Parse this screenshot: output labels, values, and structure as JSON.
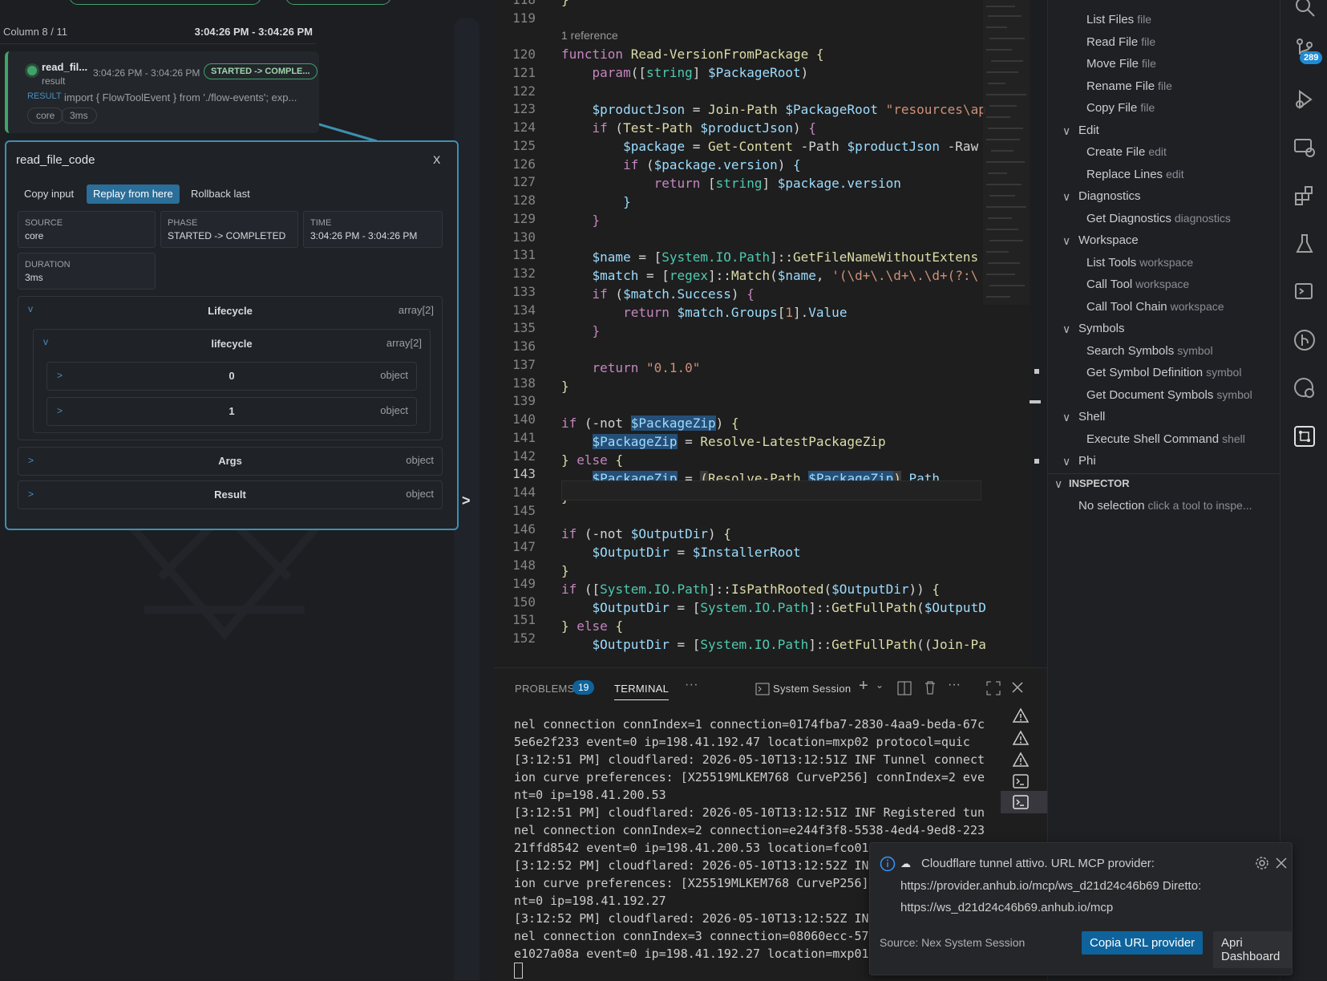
{
  "flow": {
    "column_label": "Column 8 / 11",
    "column_time": "3:04:26 PM - 3:04:26 PM",
    "node": {
      "name": "read_fil...",
      "kind": "result",
      "time": "3:04:26 PM - 3:04:26 PM",
      "phase_badge": "STARTED -> COMPLE...",
      "result_label": "RESULT",
      "result_preview": "import { FlowToolEvent } from './flow-events'; exp...",
      "chip_source": "core",
      "chip_duration": "3ms",
      "status_color": "#3fa36a"
    },
    "expand_arrow": ">"
  },
  "inspector_popup": {
    "title": "read_file_code",
    "close": "X",
    "buttons": {
      "copy_input": "Copy input",
      "replay": "Replay from here",
      "rollback": "Rollback last"
    },
    "fields": {
      "source_key": "SOURCE",
      "source_val": "core",
      "phase_key": "PHASE",
      "phase_val": "STARTED -> COMPLETED",
      "time_key": "TIME",
      "time_val": "3:04:26 PM - 3:04:26 PM",
      "duration_key": "DURATION",
      "duration_val": "3ms"
    },
    "lifecycle": {
      "chevron": "v",
      "title": "Lifecycle",
      "type": "array[2]"
    },
    "lifecycle_inner": {
      "chevron": "v",
      "title": "lifecycle",
      "type": "array[2]"
    },
    "item0": {
      "chevron": ">",
      "title": "0",
      "type": "object"
    },
    "item1": {
      "chevron": ">",
      "title": "1",
      "type": "object"
    },
    "args": {
      "chevron": ">",
      "title": "Args",
      "type": "object"
    },
    "result": {
      "chevron": ">",
      "title": "Result",
      "type": "object"
    },
    "accent_color": "#3f8fb0"
  },
  "editor": {
    "line_numbers": [
      "118",
      "119",
      "120",
      "121",
      "122",
      "123",
      "124",
      "125",
      "126",
      "127",
      "128",
      "129",
      "130",
      "131",
      "132",
      "133",
      "134",
      "135",
      "136",
      "137",
      "138",
      "139",
      "140",
      "141",
      "142",
      "143",
      "144",
      "145",
      "146",
      "147",
      "148",
      "149",
      "150",
      "151",
      "152"
    ],
    "current_line": "143",
    "codelens": "1 reference"
  },
  "panel": {
    "problems_label": "PROBLEMS",
    "problems_count": "19",
    "terminal_label": "TERMINAL",
    "more": "···",
    "session_label": "System Session",
    "terminal_lines": [
      "nel connection connIndex=1 connection=0174fba7-2830-4aa9-beda-67c",
      "5e6e2f233 event=0 ip=198.41.192.47 location=mxp02 protocol=quic",
      "[3:12:51 PM] cloudflared: 2026-05-10T13:12:51Z INF Tunnel connect",
      "ion curve preferences: [X25519MLKEM768 CurveP256] connIndex=2 eve",
      "nt=0 ip=198.41.200.53",
      "[3:12:51 PM] cloudflared: 2026-05-10T13:12:51Z INF Registered tun",
      "nel connection connIndex=2 connection=e244f3f8-5538-4ed4-9ed8-223",
      "21ffd8542 event=0 ip=198.41.200.53 location=fco01",
      "[3:12:52 PM] cloudflared: 2026-05-10T13:12:52Z IN",
      "ion curve preferences: [X25519MLKEM768 CurveP256]",
      "nt=0 ip=198.41.192.27",
      "[3:12:52 PM] cloudflared: 2026-05-10T13:12:52Z IN",
      "nel connection connIndex=3 connection=08060ecc-57",
      "e1027a08a event=0 ip=198.41.192.27 location=mxp01"
    ]
  },
  "tree": {
    "items": [
      {
        "label": "List Files",
        "desc": "file"
      },
      {
        "label": "Read File",
        "desc": "file"
      },
      {
        "label": "Move File",
        "desc": "file"
      },
      {
        "label": "Rename File",
        "desc": "file"
      },
      {
        "label": "Copy File",
        "desc": "file"
      }
    ],
    "edit_group": "Edit",
    "edit_items": [
      {
        "label": "Create File",
        "desc": "edit"
      },
      {
        "label": "Replace Lines",
        "desc": "edit"
      }
    ],
    "diag_group": "Diagnostics",
    "diag_items": [
      {
        "label": "Get Diagnostics",
        "desc": "diagnostics"
      }
    ],
    "ws_group": "Workspace",
    "ws_items": [
      {
        "label": "List Tools",
        "desc": "workspace"
      },
      {
        "label": "Call Tool",
        "desc": "workspace"
      },
      {
        "label": "Call Tool Chain",
        "desc": "workspace"
      }
    ],
    "sym_group": "Symbols",
    "sym_items": [
      {
        "label": "Search Symbols",
        "desc": "symbol"
      },
      {
        "label": "Get Symbol Definition",
        "desc": "symbol"
      },
      {
        "label": "Get Document Symbols",
        "desc": "symbol"
      }
    ],
    "shell_group": "Shell",
    "shell_items": [
      {
        "label": "Execute Shell Command",
        "desc": "shell"
      }
    ],
    "phi_group": "Phi",
    "inspector_header": "INSPECTOR",
    "inspector_empty": "No selection",
    "inspector_hint": "click a tool to inspe..."
  },
  "activity": {
    "badge": "289",
    "icons": [
      "search-icon",
      "source-control-icon",
      "run-debug-icon",
      "remote-explorer-icon",
      "extensions-icon",
      "testing-icon",
      "terminal-icon",
      "git-graph-icon",
      "timeline-icon",
      "flow-icon"
    ]
  },
  "toast": {
    "message_line1": "Cloudflare tunnel attivo. URL MCP provider:",
    "message_line2": "https://provider.anhub.io/mcp/ws_d21d24c46b69 Diretto:",
    "message_line3": "https://ws_d21d24c46b69.anhub.io/mcp",
    "source": "Source: Nex System Session",
    "primary_button": "Copia URL provider",
    "secondary_button": "Apri Dashboard"
  }
}
